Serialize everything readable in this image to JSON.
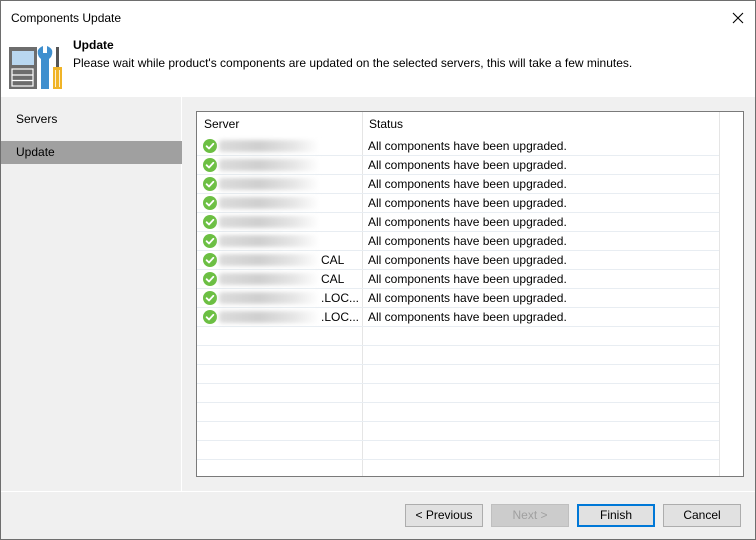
{
  "window": {
    "title": "Components Update",
    "close_icon": "close-icon"
  },
  "header": {
    "icon": "tools-server-icon",
    "title": "Update",
    "description": "Please wait while product's components are updated on the selected servers, this will take a few minutes."
  },
  "sidebar": {
    "items": [
      {
        "label": "Servers",
        "active": false
      },
      {
        "label": "Update",
        "active": true
      }
    ]
  },
  "grid": {
    "columns": [
      "Server",
      "Status"
    ],
    "rows": [
      {
        "server_suffix": "",
        "status": "All components have been upgraded.",
        "icon": "success-check-icon"
      },
      {
        "server_suffix": "",
        "status": "All components have been upgraded.",
        "icon": "success-check-icon"
      },
      {
        "server_suffix": "",
        "status": "All components have been upgraded.",
        "icon": "success-check-icon"
      },
      {
        "server_suffix": "",
        "status": "All components have been upgraded.",
        "icon": "success-check-icon"
      },
      {
        "server_suffix": "",
        "status": "All components have been upgraded.",
        "icon": "success-check-icon"
      },
      {
        "server_suffix": "",
        "status": "All components have been upgraded.",
        "icon": "success-check-icon"
      },
      {
        "server_suffix": "CAL",
        "status": "All components have been upgraded.",
        "icon": "success-check-icon"
      },
      {
        "server_suffix": "CAL",
        "status": "All components have been upgraded.",
        "icon": "success-check-icon"
      },
      {
        "server_suffix": ".LOC...",
        "status": "All components have been upgraded.",
        "icon": "success-check-icon"
      },
      {
        "server_suffix": ".LOC...",
        "status": "All components have been upgraded.",
        "icon": "success-check-icon"
      }
    ]
  },
  "buttons": {
    "previous": "< Previous",
    "next": "Next >",
    "finish": "Finish",
    "cancel": "Cancel"
  },
  "colors": {
    "success": "#6cbf43",
    "selected_nav": "#a0a0a0",
    "focus_border": "#0078d7"
  }
}
